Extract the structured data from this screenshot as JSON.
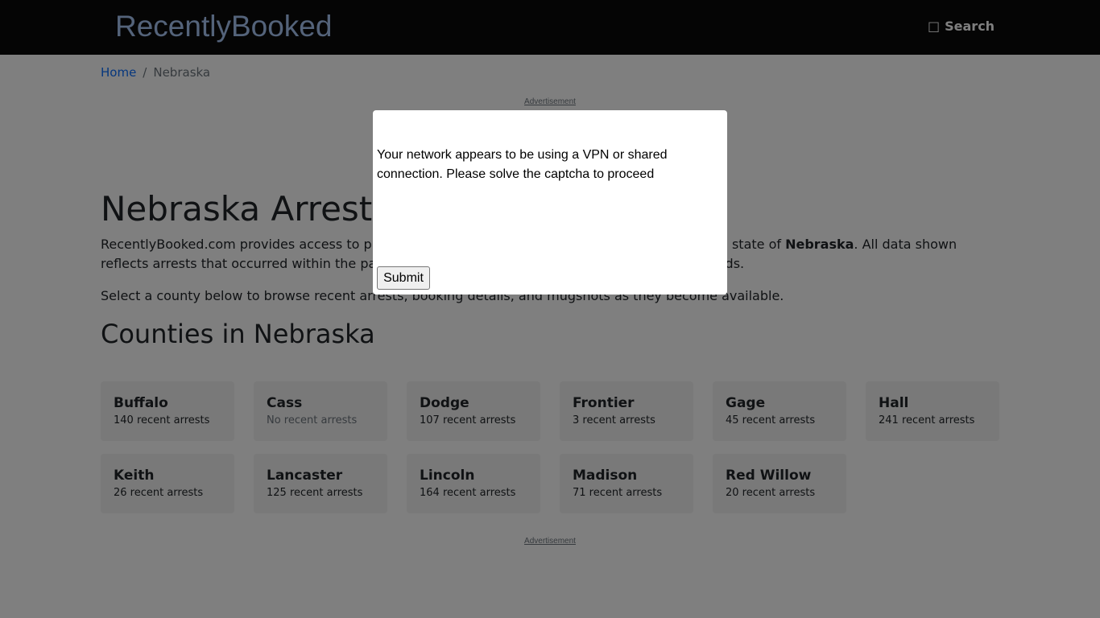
{
  "nav": {
    "brand": "RecentlyBooked",
    "search_icon": "search-icon",
    "search_glyph": "□",
    "search_label": "Search"
  },
  "breadcrumb": {
    "home": "Home",
    "separator": "/",
    "current": "Nebraska"
  },
  "ads": {
    "top_label": "Advertisement",
    "bottom_label": "Advertisement"
  },
  "main": {
    "title": "Nebraska Arrests by County",
    "intro_before": "RecentlyBooked.com provides access to public arrest and booking information for counties in the state of ",
    "intro_state": "Nebraska",
    "intro_after": ". All data shown reflects arrests that occurred within the past 30 days, compiled from county sheriff and jail records.",
    "select_text": "Select a county below to browse recent arrests, booking details, and mugshots as they become available.",
    "counties_title": "Counties in Nebraska"
  },
  "counties": [
    {
      "name": "Buffalo",
      "count": "140 recent arrests"
    },
    {
      "name": "Cass",
      "count": "No recent arrests"
    },
    {
      "name": "Dodge",
      "count": "107 recent arrests"
    },
    {
      "name": "Frontier",
      "count": "3 recent arrests"
    },
    {
      "name": "Gage",
      "count": "45 recent arrests"
    },
    {
      "name": "Hall",
      "count": "241 recent arrests"
    },
    {
      "name": "Keith",
      "count": "26 recent arrests"
    },
    {
      "name": "Lancaster",
      "count": "125 recent arrests"
    },
    {
      "name": "Lincoln",
      "count": "164 recent arrests"
    },
    {
      "name": "Madison",
      "count": "71 recent arrests"
    },
    {
      "name": "Red Willow",
      "count": "20 recent arrests"
    }
  ],
  "modal": {
    "message": "Your network appears to be using a VPN or shared connection. Please solve the captcha to proceed",
    "submit_label": "Submit"
  },
  "colors": {
    "navbar": "#0a0a0a",
    "brand": "#a9c7f5",
    "link": "#0d6efd",
    "card": "#f2f2f2",
    "overlay": "rgba(0,0,0,0.5)"
  }
}
